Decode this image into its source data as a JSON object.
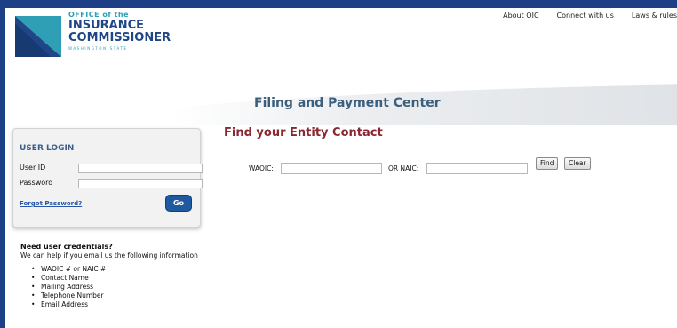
{
  "logo": {
    "line1": "OFFICE of the",
    "line2": "INSURANCE",
    "line3": "COMMISSIONER",
    "line4": "WASHINGTON STATE"
  },
  "topnav": {
    "items": [
      "About OIC",
      "Connect with us",
      "Laws & rules"
    ]
  },
  "banner": {
    "title": "Filing and Payment Center"
  },
  "login": {
    "title": "USER LOGIN",
    "user_id_label": "User ID",
    "password_label": "Password",
    "user_id_value": "",
    "password_value": "",
    "forgot_label": "Forgot Password?",
    "go_label": "Go"
  },
  "credentials": {
    "title": "Need user credentials?",
    "text": "We can help if you email us the following information",
    "items": [
      "WAOIC # or NAIC #",
      "Contact Name",
      "Mailing Address",
      "Telephone Number",
      "Email Address"
    ]
  },
  "main": {
    "title": "Find your Entity Contact",
    "waoic_label": "WAOIC:",
    "naic_label": "OR NAIC:",
    "waoic_value": "",
    "naic_value": "",
    "find_label": "Find",
    "clear_label": "Clear"
  },
  "colors": {
    "frame": "#1d3f86",
    "heading_red": "#8a2731",
    "login_title": "#3b5e88",
    "go_button": "#1f5aa0"
  }
}
